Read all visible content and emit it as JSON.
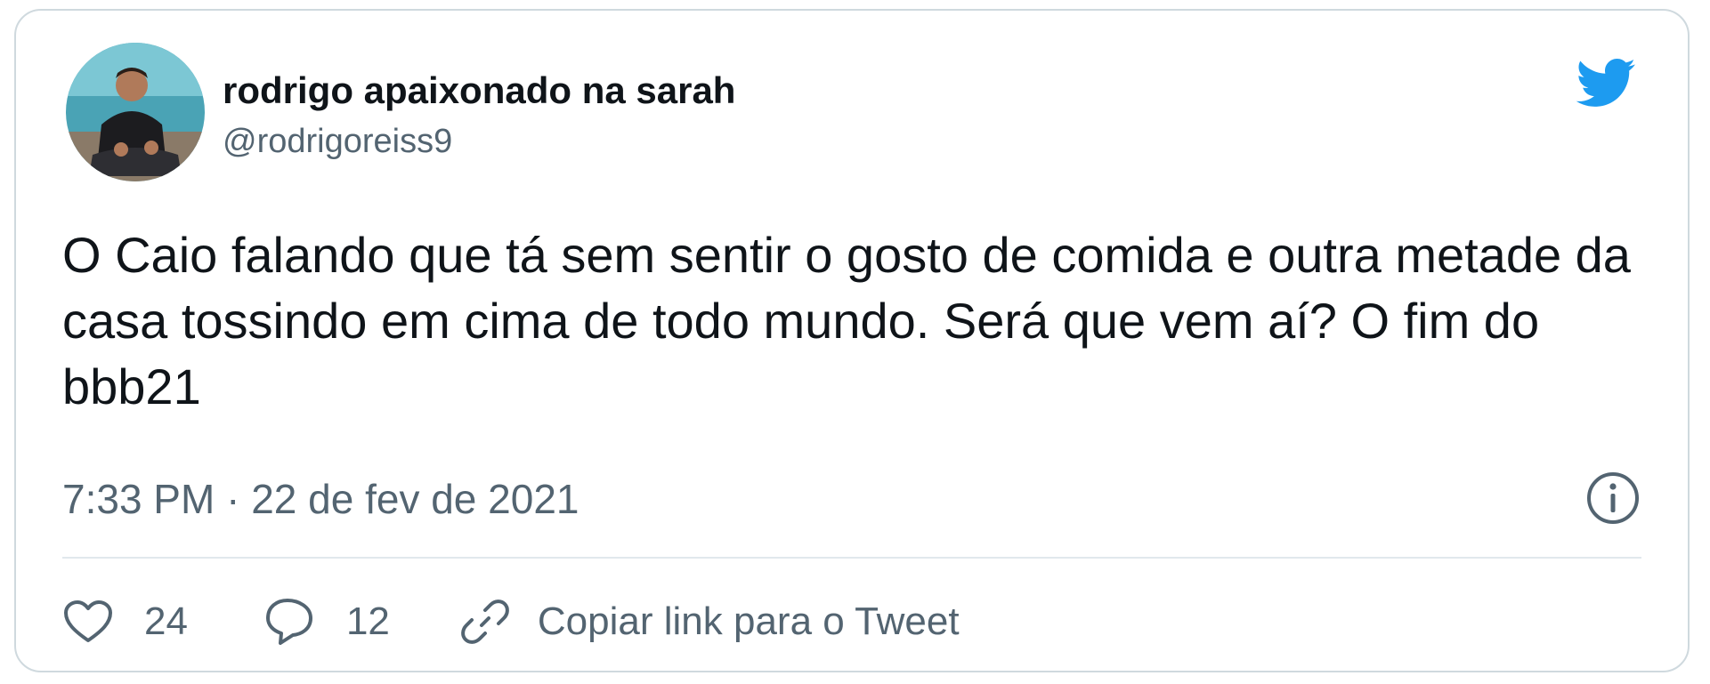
{
  "tweet": {
    "display_name": "rodrigo apaixonado na sarah",
    "handle": "@rodrigoreiss9",
    "text": "O Caio falando que tá sem sentir o gosto de comida  e outra metade da casa tossindo em cima de todo mundo. Será que vem aí? O fim do bbb21",
    "timestamp": "7:33 PM · 22 de fev de 2021"
  },
  "actions": {
    "like_count": "24",
    "reply_count": "12",
    "copy_link_label": "Copiar link para o Tweet"
  },
  "icons": {
    "brand": "twitter-bird-icon",
    "info": "info-icon",
    "like": "heart-icon",
    "reply": "speech-bubble-icon",
    "link": "chain-link-icon"
  },
  "colors": {
    "brand_blue": "#1d9bf0",
    "text_primary": "#0f1419",
    "text_secondary": "#536471",
    "border": "#cfd9de"
  }
}
